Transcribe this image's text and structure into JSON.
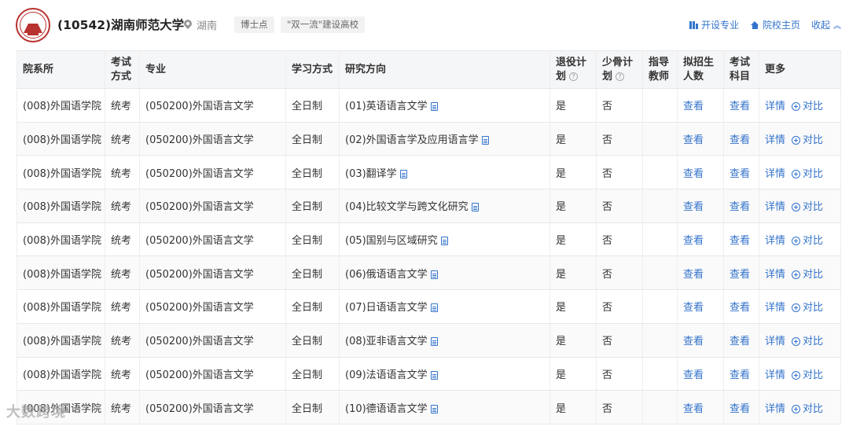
{
  "header": {
    "title": "(10542)湖南师范大学",
    "location": "湖南",
    "tags": [
      "博士点",
      "\"双一流\"建设高校"
    ],
    "links": {
      "majors": "开设专业",
      "homepage": "院校主页",
      "collapse": "收起"
    }
  },
  "table": {
    "headers": {
      "dept": "院系所",
      "exam": "考试方式",
      "major": "专业",
      "study": "学习方式",
      "direction": "研究方向",
      "veteran": "退役计划",
      "minority": "少骨计划",
      "advisor": "指导教师",
      "quota": "拟招生人数",
      "subjects": "考试科目",
      "more": "更多"
    },
    "rows": [
      {
        "dept": "(008)外国语学院",
        "exam": "统考",
        "major": "(050200)外国语言文学",
        "study": "全日制",
        "direction": "(01)英语语言文学",
        "veteran": "是",
        "minority": "否",
        "quota": "查看",
        "subjects": "查看",
        "detail": "详情",
        "compare": "对比"
      },
      {
        "dept": "(008)外国语学院",
        "exam": "统考",
        "major": "(050200)外国语言文学",
        "study": "全日制",
        "direction": "(02)外国语言学及应用语言学",
        "veteran": "是",
        "minority": "否",
        "quota": "查看",
        "subjects": "查看",
        "detail": "详情",
        "compare": "对比"
      },
      {
        "dept": "(008)外国语学院",
        "exam": "统考",
        "major": "(050200)外国语言文学",
        "study": "全日制",
        "direction": "(03)翻译学",
        "veteran": "是",
        "minority": "否",
        "quota": "查看",
        "subjects": "查看",
        "detail": "详情",
        "compare": "对比"
      },
      {
        "dept": "(008)外国语学院",
        "exam": "统考",
        "major": "(050200)外国语言文学",
        "study": "全日制",
        "direction": "(04)比较文学与跨文化研究",
        "veteran": "是",
        "minority": "否",
        "quota": "查看",
        "subjects": "查看",
        "detail": "详情",
        "compare": "对比"
      },
      {
        "dept": "(008)外国语学院",
        "exam": "统考",
        "major": "(050200)外国语言文学",
        "study": "全日制",
        "direction": "(05)国别与区域研究",
        "veteran": "是",
        "minority": "否",
        "quota": "查看",
        "subjects": "查看",
        "detail": "详情",
        "compare": "对比"
      },
      {
        "dept": "(008)外国语学院",
        "exam": "统考",
        "major": "(050200)外国语言文学",
        "study": "全日制",
        "direction": "(06)俄语语言文学",
        "veteran": "是",
        "minority": "否",
        "quota": "查看",
        "subjects": "查看",
        "detail": "详情",
        "compare": "对比"
      },
      {
        "dept": "(008)外国语学院",
        "exam": "统考",
        "major": "(050200)外国语言文学",
        "study": "全日制",
        "direction": "(07)日语语言文学",
        "veteran": "是",
        "minority": "否",
        "quota": "查看",
        "subjects": "查看",
        "detail": "详情",
        "compare": "对比"
      },
      {
        "dept": "(008)外国语学院",
        "exam": "统考",
        "major": "(050200)外国语言文学",
        "study": "全日制",
        "direction": "(08)亚非语言文学",
        "veteran": "是",
        "minority": "否",
        "quota": "查看",
        "subjects": "查看",
        "detail": "详情",
        "compare": "对比"
      },
      {
        "dept": "(008)外国语学院",
        "exam": "统考",
        "major": "(050200)外国语言文学",
        "study": "全日制",
        "direction": "(09)法语语言文学",
        "veteran": "是",
        "minority": "否",
        "quota": "查看",
        "subjects": "查看",
        "detail": "详情",
        "compare": "对比"
      },
      {
        "dept": "(008)外国语学院",
        "exam": "统考",
        "major": "(050200)外国语言文学",
        "study": "全日制",
        "direction": "(10)德语语言文学",
        "veteran": "是",
        "minority": "否",
        "quota": "查看",
        "subjects": "查看",
        "detail": "详情",
        "compare": "对比"
      }
    ]
  },
  "watermark": "大数跨境",
  "colors": {
    "link": "#3373cc",
    "logo": "#b8322f",
    "header_bg": "#f5f6f8"
  }
}
